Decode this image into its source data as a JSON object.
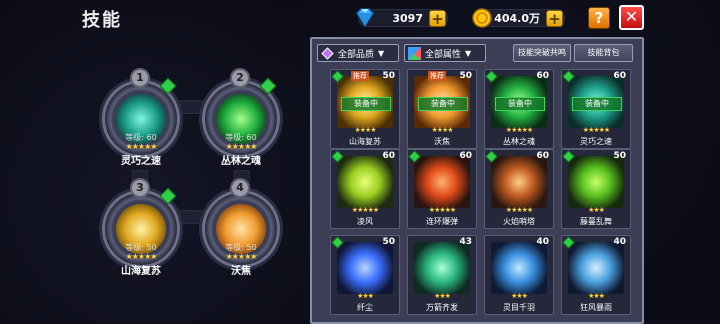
{
  "title": "技能",
  "resources": {
    "gems": "3097",
    "coins": "404.0万"
  },
  "colors": {
    "gem": "#3ab6ff",
    "coin": "#ffc414",
    "upgrade": "#2fd048",
    "star": "#ffd23a"
  },
  "buttons": {
    "help": "?",
    "close": "✕",
    "plus": "+"
  },
  "equipped": [
    {
      "slot": "1",
      "level_label": "等级: 60",
      "stars": "★★★★★",
      "name": "灵巧之速",
      "art": "teal"
    },
    {
      "slot": "2",
      "level_label": "等级: 60",
      "stars": "★★★★★",
      "name": "丛林之魂",
      "art": "green"
    },
    {
      "slot": "3",
      "level_label": "等级: 50",
      "stars": "★★★★★",
      "name": "山海复苏",
      "art": "gold"
    },
    {
      "slot": "4",
      "level_label": "等级: 50",
      "stars": "★★★★★",
      "name": "沃焦",
      "art": "orange"
    }
  ],
  "panel": {
    "filter_quality": "全部品质",
    "filter_attr": "全部属性",
    "btn_breakthrough": "技能突破共鸣",
    "btn_bag": "技能背包",
    "equipped_label": "装备中",
    "recommend_label": "推荐"
  },
  "skills": [
    {
      "name": "山海复苏",
      "level": "50",
      "stars": "★★★★",
      "equipped": true,
      "recommend": true,
      "art": "gold",
      "upgrade": true
    },
    {
      "name": "沃焦",
      "level": "50",
      "stars": "★★★★",
      "equipped": true,
      "recommend": true,
      "art": "orange",
      "upgrade": false
    },
    {
      "name": "丛林之魂",
      "level": "60",
      "stars": "★★★★★",
      "equipped": true,
      "recommend": false,
      "art": "green",
      "upgrade": true
    },
    {
      "name": "灵巧之速",
      "level": "60",
      "stars": "★★★★★",
      "equipped": true,
      "recommend": false,
      "art": "teal",
      "upgrade": true
    },
    {
      "name": "凌风",
      "level": "60",
      "stars": "★★★★★",
      "equipped": false,
      "recommend": false,
      "art": "lime",
      "upgrade": true
    },
    {
      "name": "连环爆弹",
      "level": "60",
      "stars": "★★★★★",
      "equipped": false,
      "recommend": false,
      "art": "bomb",
      "upgrade": true
    },
    {
      "name": "火焰哨塔",
      "level": "60",
      "stars": "★★★★★",
      "equipped": false,
      "recommend": false,
      "art": "tower",
      "upgrade": true
    },
    {
      "name": "藤蔓乱舞",
      "level": "50",
      "stars": "★★★",
      "equipped": false,
      "recommend": false,
      "art": "vine",
      "upgrade": true
    },
    {
      "name": "纤尘",
      "level": "50",
      "stars": "★★★",
      "equipped": false,
      "recommend": false,
      "art": "blue",
      "upgrade": true
    },
    {
      "name": "万箭齐发",
      "level": "43",
      "stars": "★★★",
      "equipped": false,
      "recommend": false,
      "art": "arrows",
      "upgrade": false
    },
    {
      "name": "灵目千羽",
      "level": "40",
      "stars": "★★★",
      "equipped": false,
      "recommend": false,
      "art": "feather",
      "upgrade": false
    },
    {
      "name": "狂风暴雨",
      "level": "40",
      "stars": "★★★",
      "equipped": false,
      "recommend": false,
      "art": "storm",
      "upgrade": true
    }
  ]
}
